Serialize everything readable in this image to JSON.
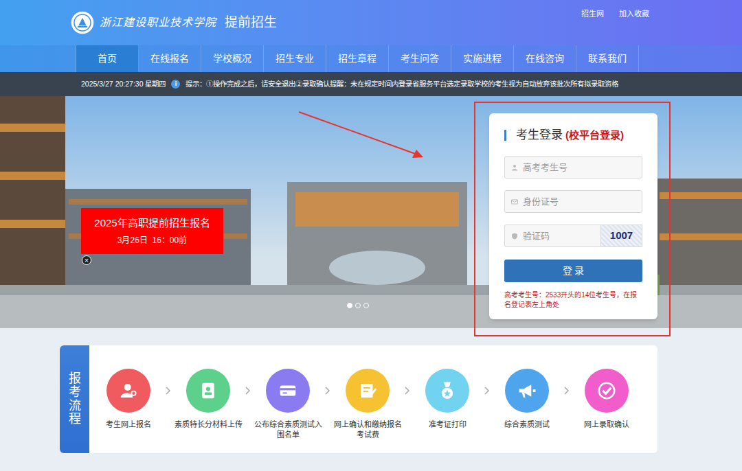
{
  "header": {
    "logo_text": "浙江建设职业技术学院",
    "title": "提前招生",
    "links": [
      "招生网",
      "加入收藏"
    ]
  },
  "nav": [
    {
      "label": "首页",
      "selected": true
    },
    {
      "label": "在线报名",
      "selected": false
    },
    {
      "label": "学校概况",
      "selected": false
    },
    {
      "label": "招生专业",
      "selected": false
    },
    {
      "label": "招生章程",
      "selected": false
    },
    {
      "label": "考生问答",
      "selected": false
    },
    {
      "label": "实施进程",
      "selected": false
    },
    {
      "label": "在线咨询",
      "selected": false
    },
    {
      "label": "联系我们",
      "selected": false
    }
  ],
  "notice": {
    "datetime": "2025/3/27 20:27:30 星期四",
    "icon": "i",
    "text": "提示：①操作完成之后，请安全退出②录取确认提醒：未在规定时间内登录省服务平台选定录取学校的考生视为自动放弃该批次所有拟录取资格"
  },
  "banner": {
    "title": "2025年高职提前招生报名",
    "subtitle": "3月26日  16：00前",
    "close": "×"
  },
  "carousel": [
    {
      "selected": true
    },
    {
      "selected": false
    },
    {
      "selected": false
    }
  ],
  "login": {
    "title": "考生登录",
    "subtitle": "(校平台登录)",
    "fields": [
      {
        "placeholder": "高考考生号"
      },
      {
        "placeholder": "身份证号"
      },
      {
        "placeholder": "验证码"
      }
    ],
    "captcha": "1007",
    "button": "登 录",
    "hint": "高考考生号：2533开头的14位考生号，在报名登记表左上角处"
  },
  "process": {
    "title": "报考流程",
    "steps": [
      {
        "label": "考生网上报名",
        "color": "#ef5b5f"
      },
      {
        "label": "素质特长分材料上传",
        "color": "#5dd08c"
      },
      {
        "label": "公布综合素质测试入围名单",
        "color": "#8b7bf0"
      },
      {
        "label": "网上确认和缴纳报名考试费",
        "color": "#f6c231"
      },
      {
        "label": "准考证打印",
        "color": "#72d3f0"
      },
      {
        "label": "综合素质测试",
        "color": "#4fa4ee"
      },
      {
        "label": "网上录取确认",
        "color": "#f15dca"
      }
    ]
  }
}
